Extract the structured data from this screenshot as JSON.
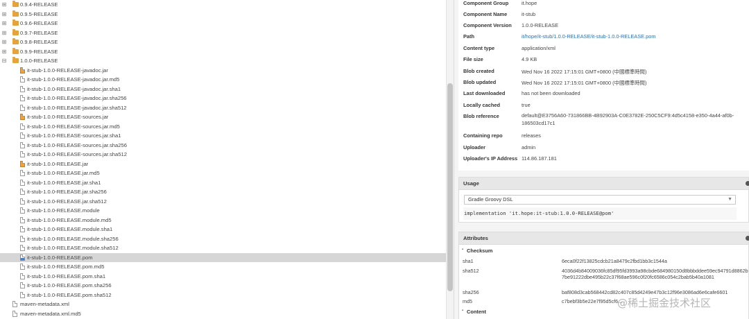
{
  "tree": {
    "versions": [
      {
        "label": "0.9.4-RELEASE"
      },
      {
        "label": "0.9.5-RELEASE"
      },
      {
        "label": "0.9.6-RELEASE"
      },
      {
        "label": "0.9.7-RELEASE"
      },
      {
        "label": "0.9.8-RELEASE"
      },
      {
        "label": "0.9.9-RELEASE"
      },
      {
        "label": "1.0.0-RELEASE"
      }
    ],
    "files": [
      {
        "label": "it-stub-1.0.0-RELEASE-javadoc.jar",
        "icon": "jar-file-icon"
      },
      {
        "label": "it-stub-1.0.0-RELEASE-javadoc.jar.md5",
        "icon": "file-icon"
      },
      {
        "label": "it-stub-1.0.0-RELEASE-javadoc.jar.sha1",
        "icon": "file-icon"
      },
      {
        "label": "it-stub-1.0.0-RELEASE-javadoc.jar.sha256",
        "icon": "file-icon"
      },
      {
        "label": "it-stub-1.0.0-RELEASE-javadoc.jar.sha512",
        "icon": "file-icon"
      },
      {
        "label": "it-stub-1.0.0-RELEASE-sources.jar",
        "icon": "jar-file-icon"
      },
      {
        "label": "it-stub-1.0.0-RELEASE-sources.jar.md5",
        "icon": "file-icon"
      },
      {
        "label": "it-stub-1.0.0-RELEASE-sources.jar.sha1",
        "icon": "file-icon"
      },
      {
        "label": "it-stub-1.0.0-RELEASE-sources.jar.sha256",
        "icon": "file-icon"
      },
      {
        "label": "it-stub-1.0.0-RELEASE-sources.jar.sha512",
        "icon": "file-icon"
      },
      {
        "label": "it-stub-1.0.0-RELEASE.jar",
        "icon": "jar-file-icon"
      },
      {
        "label": "it-stub-1.0.0-RELEASE.jar.md5",
        "icon": "file-icon"
      },
      {
        "label": "it-stub-1.0.0-RELEASE.jar.sha1",
        "icon": "file-icon"
      },
      {
        "label": "it-stub-1.0.0-RELEASE.jar.sha256",
        "icon": "file-icon"
      },
      {
        "label": "it-stub-1.0.0-RELEASE.jar.sha512",
        "icon": "file-icon"
      },
      {
        "label": "it-stub-1.0.0-RELEASE.module",
        "icon": "file-icon"
      },
      {
        "label": "it-stub-1.0.0-RELEASE.module.md5",
        "icon": "file-icon"
      },
      {
        "label": "it-stub-1.0.0-RELEASE.module.sha1",
        "icon": "file-icon"
      },
      {
        "label": "it-stub-1.0.0-RELEASE.module.sha256",
        "icon": "file-icon"
      },
      {
        "label": "it-stub-1.0.0-RELEASE.module.sha512",
        "icon": "file-icon"
      },
      {
        "label": "it-stub-1.0.0-RELEASE.pom",
        "icon": "pom-file-icon",
        "selected": true
      },
      {
        "label": "it-stub-1.0.0-RELEASE.pom.md5",
        "icon": "file-icon"
      },
      {
        "label": "it-stub-1.0.0-RELEASE.pom.sha1",
        "icon": "file-icon"
      },
      {
        "label": "it-stub-1.0.0-RELEASE.pom.sha256",
        "icon": "file-icon"
      },
      {
        "label": "it-stub-1.0.0-RELEASE.pom.sha512",
        "icon": "file-icon"
      }
    ],
    "root_files": [
      {
        "label": "maven-metadata.xml"
      },
      {
        "label": "maven-metadata.xml.md5"
      }
    ]
  },
  "info": {
    "component_group_label": "Component Group",
    "component_group": "it.hope",
    "component_name_label": "Component Name",
    "component_name": "it-stub",
    "component_version_label": "Component Version",
    "component_version": "1.0.0-RELEASE",
    "path_label": "Path",
    "path": "it/hope/it-stub/1.0.0-RELEASE/it-stub-1.0.0-RELEASE.pom",
    "content_type_label": "Content type",
    "content_type": "application/xml",
    "file_size_label": "File size",
    "file_size": "4.9 KB",
    "blob_created_label": "Blob created",
    "blob_created": "Wed Nov 16 2022 17:15:01 GMT+0800 (中國標準時間)",
    "blob_updated_label": "Blob updated",
    "blob_updated": "Wed Nov 16 2022 17:15:01 GMT+0800 (中國標準時間)",
    "last_downloaded_label": "Last downloaded",
    "last_downloaded": "has not been downloaded",
    "locally_cached_label": "Locally cached",
    "locally_cached": "true",
    "blob_reference_label": "Blob reference",
    "blob_reference": "default@E3756A60-731866BB-4B92903A-C0E3782E-250C5CF9:4d5c4158-e350-4a44-af0b-186503cd17c1",
    "containing_repo_label": "Containing repo",
    "containing_repo": "releases",
    "uploader_label": "Uploader",
    "uploader": "admin",
    "uploader_ip_label": "Uploader's IP Address",
    "uploader_ip": "114.86.187.181"
  },
  "usage": {
    "title": "Usage",
    "selected_option": "Gradle Groovy DSL",
    "snippet": "implementation 'it.hope:it-stub:1.0.0-RELEASE@pom'"
  },
  "attributes": {
    "title": "Attributes",
    "checksum_title": "Checksum",
    "checksums": [
      {
        "label": "sha1",
        "value": "6eca0f22f13825cdcb21a8479c2fbd1bb3c1544a"
      },
      {
        "label": "sha512",
        "value": "4036d4b84009036fc85df95fd3993a98cbde684980150d8bbbddee59ec94791d8862b7be91222dbe495b22c37f68ae596c0f20fc6586c054c2bab5b40a1081"
      },
      {
        "label": "sha256",
        "value": "baf808d3cab568442cd82c407c85d4249e47b3c12f96e3086ad6e6cafe6601"
      },
      {
        "label": "md5",
        "value": "c7bebf3b5e22e7f95d5cf6..."
      }
    ],
    "content_title": "Content"
  },
  "watermark": "@稀土掘金技术社区"
}
